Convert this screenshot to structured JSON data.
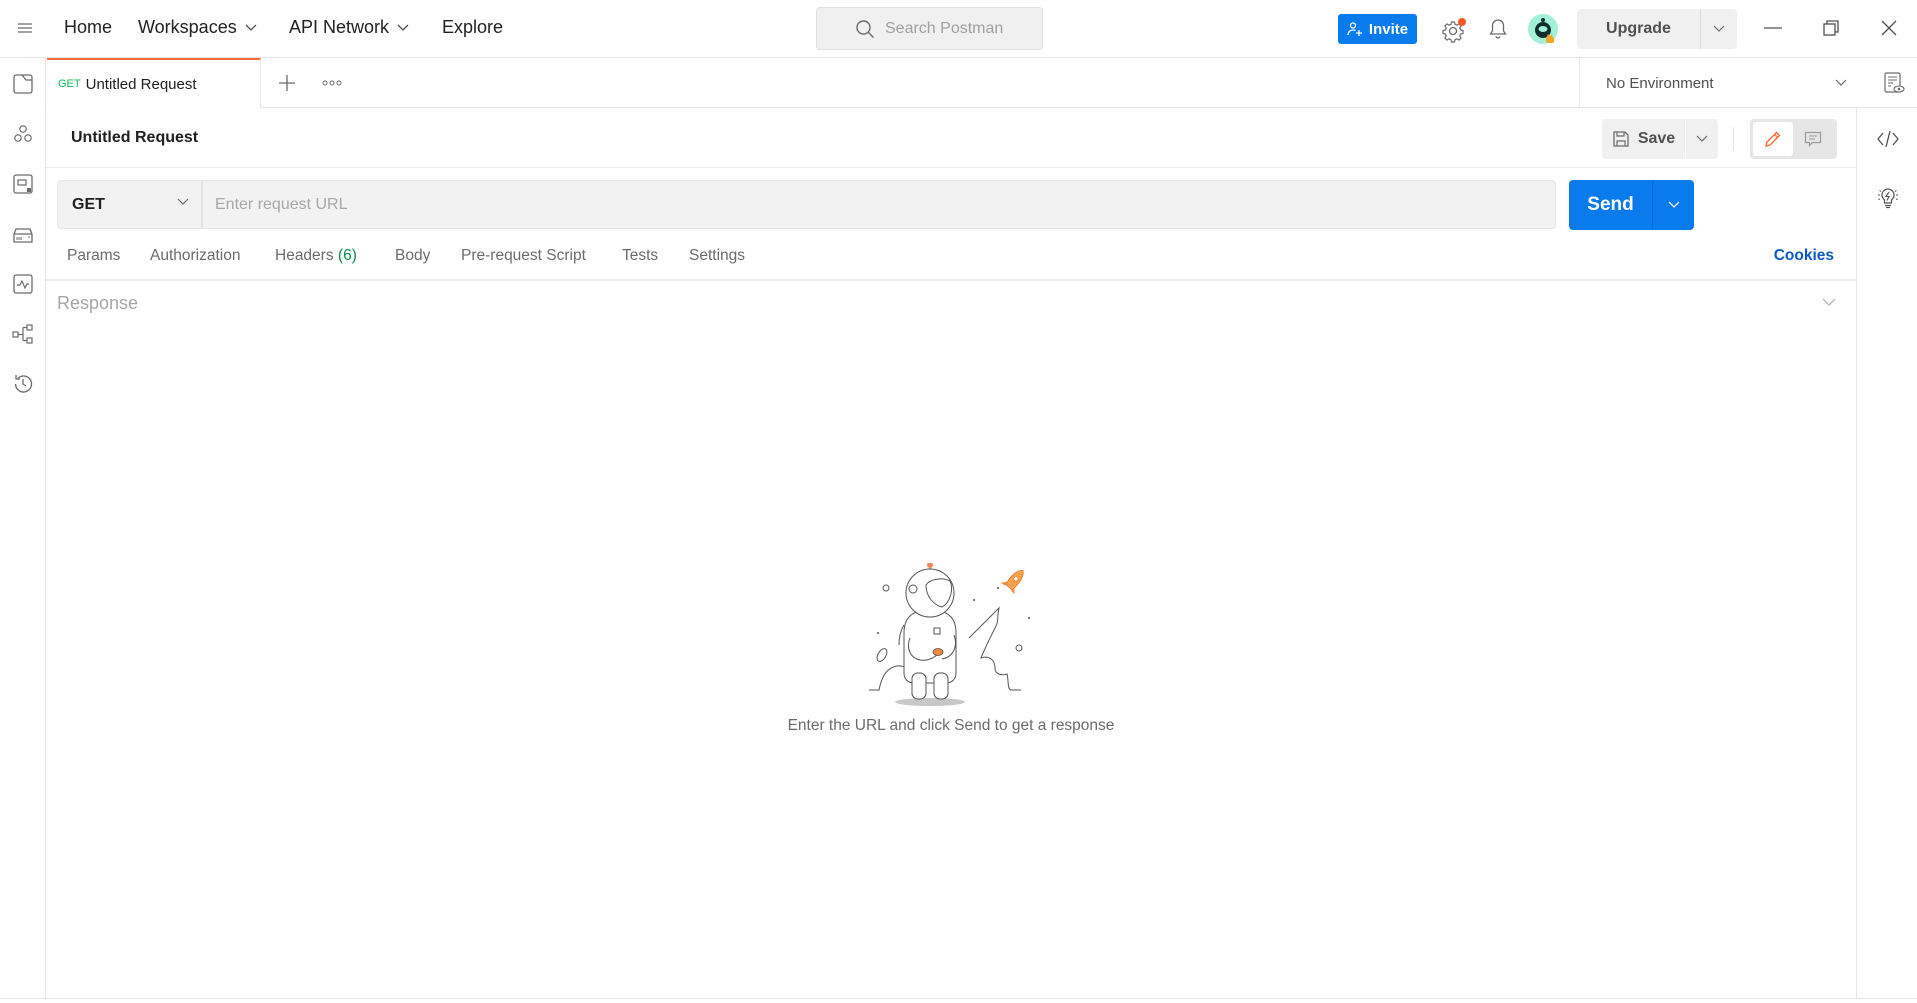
{
  "topbar": {
    "nav": [
      {
        "label": "Home",
        "has_dropdown": false
      },
      {
        "label": "Workspaces",
        "has_dropdown": true
      },
      {
        "label": "API Network",
        "has_dropdown": true
      },
      {
        "label": "Explore",
        "has_dropdown": false
      }
    ],
    "search_placeholder": "Search Postman",
    "invite_label": "Invite",
    "upgrade_label": "Upgrade",
    "icons": [
      "menu-icon",
      "settings-icon",
      "bell-icon",
      "avatar",
      "minimize-icon",
      "restore-icon",
      "close-icon"
    ],
    "settings_has_notification": true
  },
  "sidebar": {
    "items": [
      {
        "name": "collections",
        "icon": "collections-icon"
      },
      {
        "name": "apis",
        "icon": "apis-icon"
      },
      {
        "name": "environments",
        "icon": "environments-icon"
      },
      {
        "name": "mock-servers",
        "icon": "mock-servers-icon"
      },
      {
        "name": "monitors",
        "icon": "monitors-icon"
      },
      {
        "name": "flows",
        "icon": "flows-icon"
      },
      {
        "name": "history",
        "icon": "history-icon"
      }
    ]
  },
  "tabs": {
    "active": {
      "method": "GET",
      "title": "Untitled Request"
    },
    "environment": "No Environment"
  },
  "request": {
    "title": "Untitled Request",
    "save_label": "Save",
    "method": "GET",
    "url_value": "",
    "url_placeholder": "Enter request URL",
    "send_label": "Send",
    "tabs": [
      {
        "label": "Params"
      },
      {
        "label": "Authorization"
      },
      {
        "label": "Headers",
        "count": "(6)"
      },
      {
        "label": "Body"
      },
      {
        "label": "Pre-request Script"
      },
      {
        "label": "Tests"
      },
      {
        "label": "Settings"
      }
    ],
    "cookies_label": "Cookies"
  },
  "response": {
    "label": "Response",
    "empty_message": "Enter the URL and click Send to get a response"
  },
  "colors": {
    "accent": "#ff6c37",
    "primary": "#097bed",
    "link": "#0b5bc4",
    "get_method": "#0cbb52",
    "count": "#0c8a4c"
  }
}
